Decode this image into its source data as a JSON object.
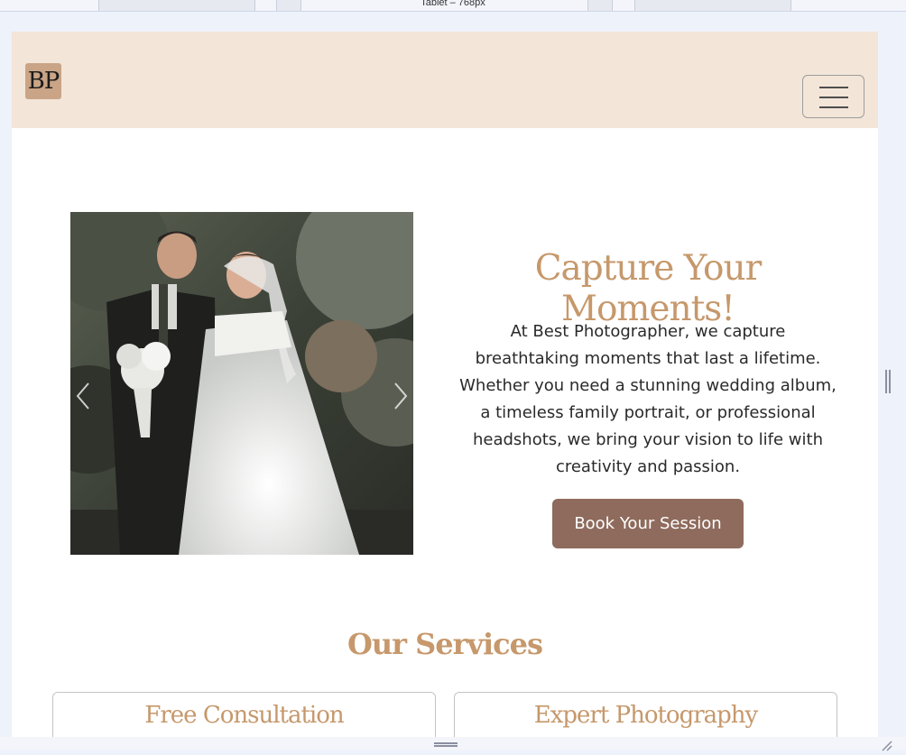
{
  "devtools": {
    "device_label": "Tablet – 768px"
  },
  "header": {
    "logo_text": "BP",
    "menu_icon": "hamburger-menu-icon"
  },
  "hero": {
    "image_alt": "wedding-couple-photo",
    "prev_icon": "chevron-left-icon",
    "next_icon": "chevron-right-icon",
    "title": "Capture Your Moments!",
    "lines": [
      "At Best Photographer, we capture",
      "breathtaking moments that last a lifetime.",
      "Whether you need a stunning wedding album,",
      "a timeless family portrait, or professional",
      "headshots, we bring your vision to life with",
      "creativity and passion."
    ],
    "cta_label": "Book Your Session"
  },
  "services": {
    "title": "Our Services",
    "cards": [
      {
        "title": "Free Consultation"
      },
      {
        "title": "Expert Photography"
      }
    ]
  },
  "colors": {
    "header_bg": "#f3e5d8",
    "accent_gold": "#c6986b",
    "button_brown": "#8e6b5c",
    "logo_bg": "#c9a486"
  }
}
